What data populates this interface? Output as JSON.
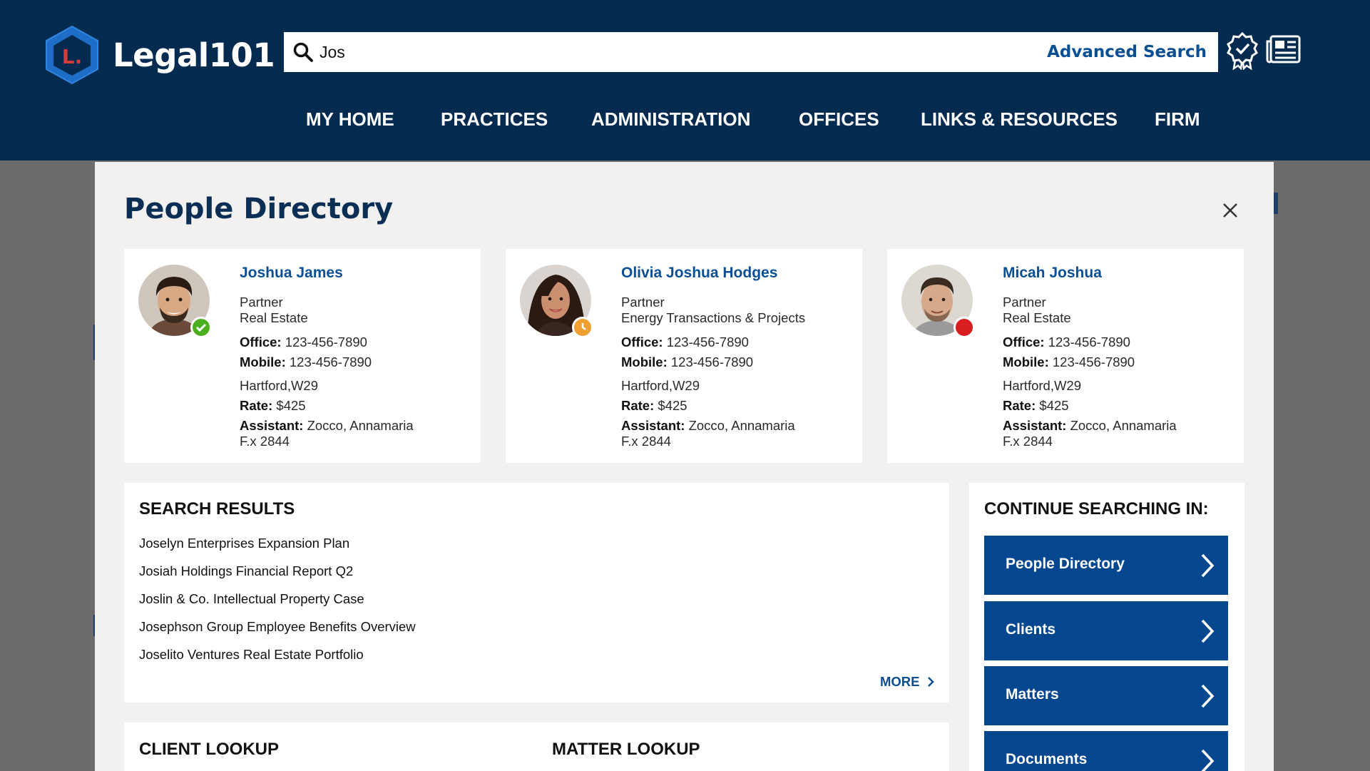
{
  "header": {
    "logo_text": "Legal101",
    "logo_letter": "L.",
    "search": {
      "value": "Jos",
      "placeholder": ""
    },
    "advanced_search_label": "Advanced Search",
    "icons": [
      "award-icon",
      "newspaper-icon"
    ],
    "nav": [
      "MY HOME",
      "PRACTICES",
      "ADMINISTRATION",
      "OFFICES",
      "LINKS & RESOURCES",
      "FIRM"
    ]
  },
  "modal": {
    "title": "People Directory",
    "people": [
      {
        "name": "Joshua James",
        "title": "Partner",
        "practice": "Real Estate",
        "office_label": "Office:",
        "office": "123-456-7890",
        "mobile_label": "Mobile:",
        "mobile": "123-456-7890",
        "location": "Hartford,W29",
        "rate_label": "Rate:",
        "rate": "$425",
        "assistant_label": "Assistant:",
        "assistant": "Zocco, Annamaria",
        "ext": "F.x 2844",
        "status": "available",
        "status_color": "#4caf1e"
      },
      {
        "name": "Olivia Joshua Hodges",
        "title": "Partner",
        "practice": "Energy Transactions & Projects",
        "office_label": "Office:",
        "office": "123-456-7890",
        "mobile_label": "Mobile:",
        "mobile": "123-456-7890",
        "location": "Hartford,W29",
        "rate_label": "Rate:",
        "rate": "$425",
        "assistant_label": "Assistant:",
        "assistant": "Zocco, Annamaria",
        "ext": "F.x 2844",
        "status": "away",
        "status_color": "#f0a030"
      },
      {
        "name": "Micah Joshua",
        "title": "Partner",
        "practice": "Real Estate",
        "office_label": "Office:",
        "office": "123-456-7890",
        "mobile_label": "Mobile:",
        "mobile": "123-456-7890",
        "location": "Hartford,W29",
        "rate_label": "Rate:",
        "rate": "$425",
        "assistant_label": "Assistant:",
        "assistant": "Zocco, Annamaria",
        "ext": "F.x 2844",
        "status": "busy",
        "status_color": "#d81e1e"
      }
    ],
    "search_results": {
      "heading": "SEARCH RESULTS",
      "items": [
        "Joselyn Enterprises Expansion Plan",
        "Josiah Holdings Financial Report Q2",
        "Joslin & Co. Intellectual Property Case",
        "Josephson Group Employee Benefits Overview",
        "Joselito Ventures Real Estate Portfolio"
      ],
      "more_label": "MORE"
    },
    "continue_searching": {
      "heading": "CONTINUE SEARCHING IN:",
      "items": [
        "People Directory",
        "Clients",
        "Matters",
        "Documents"
      ]
    },
    "lookups": {
      "client": "CLIENT LOOKUP",
      "matter": "MATTER LOOKUP"
    }
  },
  "colors": {
    "header_bg": "#032a4f",
    "accent_blue": "#05478f",
    "link_blue": "#0a4f94",
    "title_navy": "#0b2e55",
    "modal_bg": "#f2f1ef"
  }
}
